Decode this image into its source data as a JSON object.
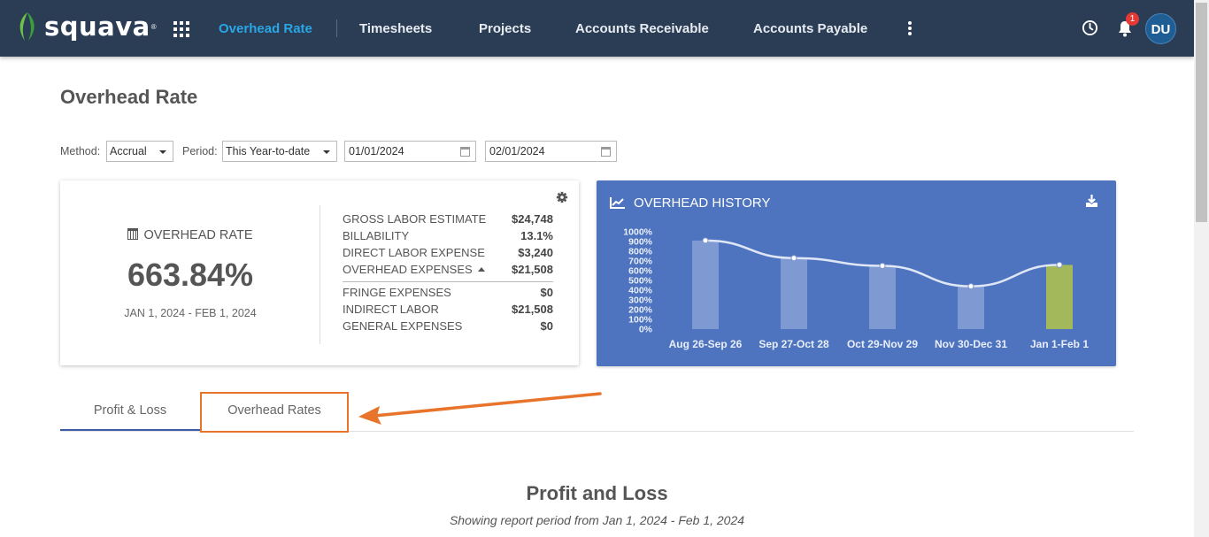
{
  "app": {
    "name": "squava",
    "tm": "®"
  },
  "nav": {
    "items": [
      {
        "label": "Overhead Rate",
        "active": true
      },
      {
        "label": "Timesheets"
      },
      {
        "label": "Projects"
      },
      {
        "label": "Accounts Receivable"
      },
      {
        "label": "Accounts Payable"
      }
    ],
    "notification_count": "1",
    "avatar_initials": "DU"
  },
  "page": {
    "title": "Overhead Rate"
  },
  "filters": {
    "method_label": "Method:",
    "method_value": "Accrual",
    "period_label": "Period:",
    "period_value": "This Year-to-date",
    "start_date": "01/01/2024",
    "end_date": "02/01/2024"
  },
  "summary": {
    "label": "OVERHEAD RATE",
    "value": "663.84%",
    "period": "JAN 1, 2024 - FEB 1, 2024",
    "metrics": [
      {
        "label": "GROSS LABOR ESTIMATE",
        "value": "$24,748"
      },
      {
        "label": "BILLABILITY",
        "value": "13.1%"
      },
      {
        "label": "DIRECT LABOR EXPENSE",
        "value": "$3,240"
      },
      {
        "label": "OVERHEAD EXPENSES",
        "value": "$21,508"
      },
      {
        "label": "FRINGE EXPENSES",
        "value": "$0"
      },
      {
        "label": "INDIRECT LABOR",
        "value": "$21,508"
      },
      {
        "label": "GENERAL EXPENSES",
        "value": "$0"
      }
    ]
  },
  "history": {
    "title": "OVERHEAD HISTORY",
    "colors": {
      "bar": "#7f9ad3",
      "highlight_bar": "#a3b85a",
      "line": "#dfe6f5"
    }
  },
  "chart_data": {
    "type": "bar",
    "categories": [
      "Aug 26-Sep 26",
      "Sep 27-Oct 28",
      "Oct 29-Nov 29",
      "Nov 30-Dec 31",
      "Jan 1-Feb 1"
    ],
    "values": [
      910,
      730,
      650,
      440,
      660
    ],
    "line_values": [
      910,
      730,
      650,
      440,
      660
    ],
    "yticks": [
      "0%",
      "100%",
      "200%",
      "300%",
      "400%",
      "500%",
      "600%",
      "700%",
      "800%",
      "900%",
      "1000%"
    ],
    "ylim": [
      0,
      1000
    ],
    "title": "OVERHEAD HISTORY",
    "highlight_index": 4
  },
  "tabs": [
    {
      "label": "Profit & Loss",
      "active": true
    },
    {
      "label": "Overhead Rates"
    }
  ],
  "report": {
    "title": "Profit and Loss",
    "subtitle": "Showing report period from Jan 1, 2024 - Feb 1, 2024"
  }
}
